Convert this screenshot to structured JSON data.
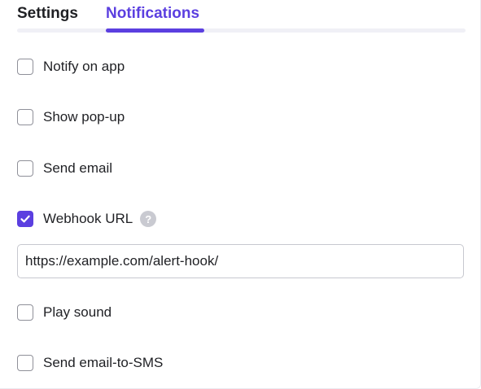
{
  "tabs": [
    {
      "label": "Settings",
      "active": false
    },
    {
      "label": "Notifications",
      "active": true
    }
  ],
  "options": [
    {
      "label": "Notify on app",
      "checked": false
    },
    {
      "label": "Show pop-up",
      "checked": false
    },
    {
      "label": "Send email",
      "checked": false
    },
    {
      "label": "Webhook URL",
      "checked": true,
      "help_icon": "question-circle-icon"
    },
    {
      "label": "Play sound",
      "checked": false
    },
    {
      "label": "Send email-to-SMS",
      "checked": false
    }
  ],
  "webhook": {
    "value": "https://example.com/alert-hook/",
    "help_glyph": "?"
  },
  "colors": {
    "accent": "#5b3fe0",
    "checkbox_border": "#8f9099",
    "help_icon": "#c9cad1",
    "tab_track": "#f0f0f6"
  }
}
